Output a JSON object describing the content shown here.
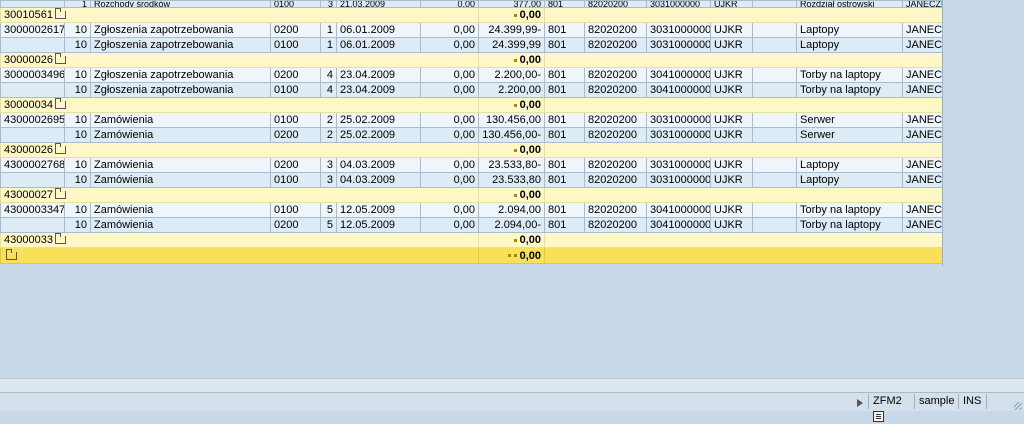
{
  "rows": [
    {
      "kind": "cut",
      "doc": "",
      "item": "1",
      "type": "Rozchody środków",
      "code": "0100",
      "n": "3",
      "date": "21.03.2009",
      "v1": "0,00",
      "amount": "377,00",
      "c1": "801",
      "acct": "82020200",
      "fund": "3031000000",
      "org": "UJKR",
      "e1": "",
      "desc": "Rozdział ostrowski",
      "user": "JANECZEKM"
    },
    {
      "kind": "sub",
      "doc": "30010561",
      "marker": "",
      "amount": "0,00"
    },
    {
      "kind": "a",
      "doc": "3000002617",
      "item": "10",
      "type": "Zgłoszenia zapotrzebowania",
      "code": "0200",
      "n": "1",
      "date": "06.01.2009",
      "v1": "0,00",
      "amount": "24.399,99-",
      "c1": "801",
      "acct": "82020200",
      "fund": "3031000000",
      "org": "UJKR",
      "e1": "",
      "desc": "Laptopy",
      "user": "JANECZEKM"
    },
    {
      "kind": "b",
      "doc": "",
      "item": "10",
      "type": "Zgłoszenia zapotrzebowania",
      "code": "0100",
      "n": "1",
      "date": "06.01.2009",
      "v1": "0,00",
      "amount": "24.399,99",
      "c1": "801",
      "acct": "82020200",
      "fund": "3031000000",
      "org": "UJKR",
      "e1": "",
      "desc": "Laptopy",
      "user": "JANECZEKM"
    },
    {
      "kind": "sub",
      "doc": "30000026",
      "amount": "0,00"
    },
    {
      "kind": "a",
      "doc": "3000003496",
      "item": "10",
      "type": "Zgłoszenia zapotrzebowania",
      "code": "0200",
      "n": "4",
      "date": "23.04.2009",
      "v1": "0,00",
      "amount": "2.200,00-",
      "c1": "801",
      "acct": "82020200",
      "fund": "3041000000",
      "org": "UJKR",
      "e1": "",
      "desc": "Torby na laptopy",
      "user": "JANECZEKM"
    },
    {
      "kind": "b",
      "doc": "",
      "item": "10",
      "type": "Zgłoszenia zapotrzebowania",
      "code": "0100",
      "n": "4",
      "date": "23.04.2009",
      "v1": "0,00",
      "amount": "2.200,00",
      "c1": "801",
      "acct": "82020200",
      "fund": "3041000000",
      "org": "UJKR",
      "e1": "",
      "desc": "Torby na laptopy",
      "user": "JANECZEKM"
    },
    {
      "kind": "sub",
      "doc": "30000034",
      "amount": "0,00"
    },
    {
      "kind": "a",
      "doc": "4300002695",
      "item": "10",
      "type": "Zamówienia",
      "code": "0100",
      "n": "2",
      "date": "25.02.2009",
      "v1": "0,00",
      "amount": "130.456,00",
      "c1": "801",
      "acct": "82020200",
      "fund": "3031000000",
      "org": "UJKR",
      "e1": "",
      "desc": "Serwer",
      "user": "JANECZEKM"
    },
    {
      "kind": "b",
      "doc": "",
      "item": "10",
      "type": "Zamówienia",
      "code": "0200",
      "n": "2",
      "date": "25.02.2009",
      "v1": "0,00",
      "amount": "130.456,00-",
      "c1": "801",
      "acct": "82020200",
      "fund": "3031000000",
      "org": "UJKR",
      "e1": "",
      "desc": "Serwer",
      "user": "JANECZEKM"
    },
    {
      "kind": "sub",
      "doc": "43000026",
      "amount": "0,00"
    },
    {
      "kind": "a",
      "doc": "4300002768",
      "item": "10",
      "type": "Zamówienia",
      "code": "0200",
      "n": "3",
      "date": "04.03.2009",
      "v1": "0,00",
      "amount": "23.533,80-",
      "c1": "801",
      "acct": "82020200",
      "fund": "3031000000",
      "org": "UJKR",
      "e1": "",
      "desc": "Laptopy",
      "user": "JANECZEKM"
    },
    {
      "kind": "b",
      "doc": "",
      "item": "10",
      "type": "Zamówienia",
      "code": "0100",
      "n": "3",
      "date": "04.03.2009",
      "v1": "0,00",
      "amount": "23.533,80",
      "c1": "801",
      "acct": "82020200",
      "fund": "3031000000",
      "org": "UJKR",
      "e1": "",
      "desc": "Laptopy",
      "user": "JANECZEKM"
    },
    {
      "kind": "sub",
      "doc": "43000027",
      "amount": "0,00"
    },
    {
      "kind": "a",
      "doc": "4300003347",
      "item": "10",
      "type": "Zamówienia",
      "code": "0100",
      "n": "5",
      "date": "12.05.2009",
      "v1": "0,00",
      "amount": "2.094,00",
      "c1": "801",
      "acct": "82020200",
      "fund": "3041000000",
      "org": "UJKR",
      "e1": "",
      "desc": "Torby na laptopy",
      "user": "JANECZEKM"
    },
    {
      "kind": "b",
      "doc": "",
      "item": "10",
      "type": "Zamówienia",
      "code": "0200",
      "n": "5",
      "date": "12.05.2009",
      "v1": "0,00",
      "amount": "2.094,00-",
      "c1": "801",
      "acct": "82020200",
      "fund": "3041000000",
      "org": "UJKR",
      "e1": "",
      "desc": "Torby na laptopy",
      "user": "JANECZEKM"
    },
    {
      "kind": "sub",
      "doc": "43000033",
      "amount": "0,00"
    },
    {
      "kind": "total",
      "doc": "",
      "amount": "0,00"
    }
  ],
  "status": {
    "system": "ZFM2",
    "client": "sample",
    "mode": "INS"
  },
  "colors": {
    "row_a": "#eef6fb",
    "row_b": "#dcebf5",
    "subtotal": "#fff8c6",
    "total": "#f8e05a",
    "background": "#c9d9e9"
  }
}
